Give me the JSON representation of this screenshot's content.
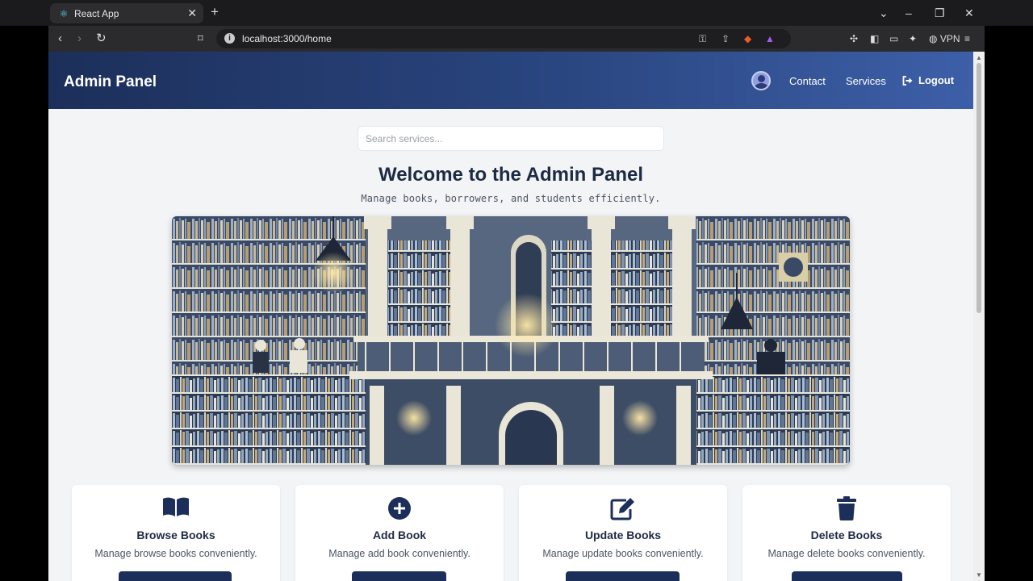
{
  "browser": {
    "tab_title": "React App",
    "url": "localhost:3000/home",
    "vpn_label": "VPN"
  },
  "header": {
    "brand": "Admin Panel",
    "nav": {
      "contact": "Contact",
      "services": "Services",
      "logout": "Logout"
    }
  },
  "search": {
    "placeholder": "Search services...",
    "value": ""
  },
  "hero": {
    "title": "Welcome to the Admin Panel",
    "subtitle": "Manage books, borrowers, and students efficiently."
  },
  "cards": [
    {
      "icon": "open-book-icon",
      "title": "Browse Books",
      "description": "Manage browse books conveniently."
    },
    {
      "icon": "plus-circle-icon",
      "title": "Add Book",
      "description": "Manage add book conveniently."
    },
    {
      "icon": "edit-icon",
      "title": "Update Books",
      "description": "Manage update books conveniently."
    },
    {
      "icon": "trash-icon",
      "title": "Delete Books",
      "description": "Manage delete books conveniently."
    }
  ],
  "colors": {
    "header_start": "#1c2f5a",
    "header_end": "#3d5fa8",
    "page_bg": "#f3f4f6",
    "text_dark": "#1e2a44",
    "button_bg": "#1c2f5a"
  }
}
